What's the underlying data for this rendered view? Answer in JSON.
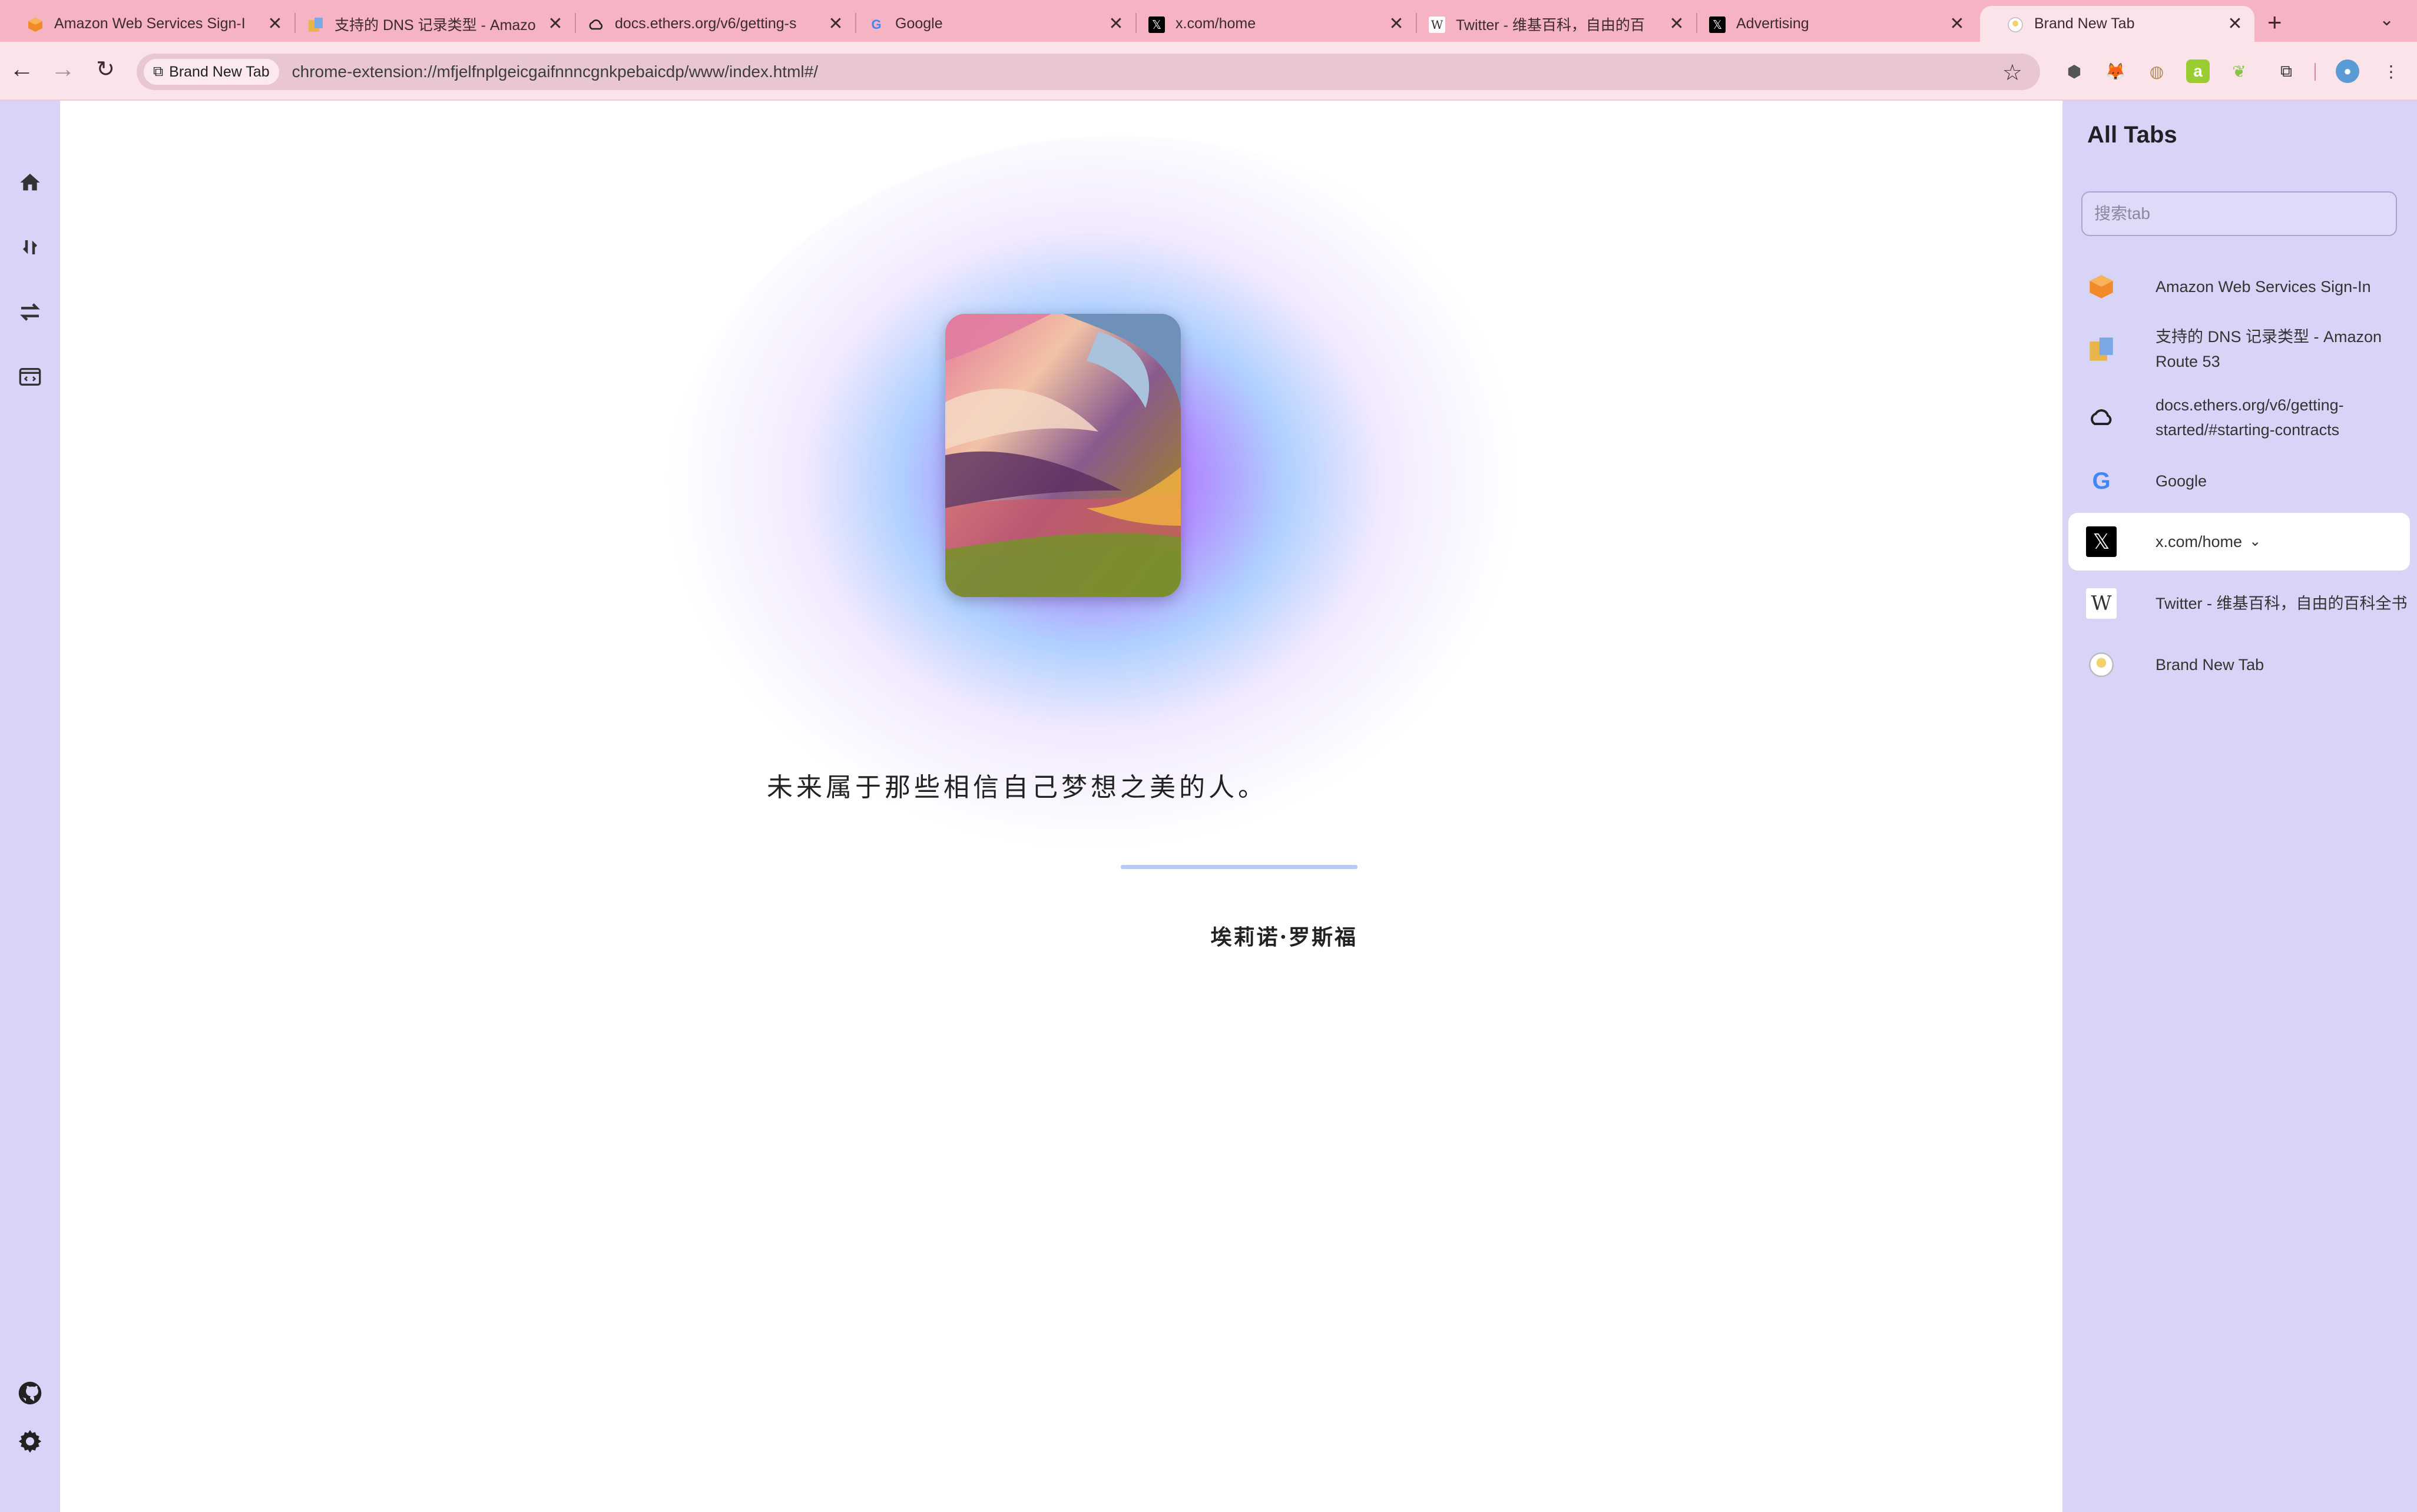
{
  "browser": {
    "tabs": [
      {
        "title": "Amazon Web Services Sign-I",
        "icon": "aws-cube-icon"
      },
      {
        "title": "支持的 DNS 记录类型 - Amazo",
        "icon": "route53-icon"
      },
      {
        "title": "docs.ethers.org/v6/getting-s",
        "icon": "cloud-icon"
      },
      {
        "title": "Google",
        "icon": "google-g-icon"
      },
      {
        "title": "x.com/home",
        "icon": "x-logo-icon"
      },
      {
        "title": "Twitter - 维基百科，自由的百",
        "icon": "wikipedia-w-icon"
      },
      {
        "title": "Advertising",
        "icon": "x-logo-icon"
      },
      {
        "title": "Brand New Tab",
        "icon": "bulb-icon"
      }
    ],
    "site_chip": "Brand New Tab",
    "url": "chrome-extension://mfjelfnplgeicgaifnnncgnkpebaicdp/www/index.html#/"
  },
  "sidebar_left": {
    "items": [
      "home-icon",
      "swap-vertical-icon",
      "swap-arrows-icon",
      "code-window-icon",
      "github-icon",
      "settings-icon"
    ]
  },
  "main": {
    "quote": "未来属于那些相信自己梦想之美的人。",
    "author": "埃莉诺·罗斯福"
  },
  "panel": {
    "title": "All Tabs",
    "search_placeholder": "搜索tab",
    "items": [
      {
        "title": "Amazon Web Services Sign-In",
        "icon": "aws-cube-icon"
      },
      {
        "title": "支持的 DNS 记录类型 - Amazon Route 53",
        "icon": "route53-icon"
      },
      {
        "title": "docs.ethers.org/v6/getting-started/#starting-contracts",
        "icon": "cloud-icon"
      },
      {
        "title": "Google",
        "icon": "google-g-icon"
      },
      {
        "title": "x.com/home",
        "icon": "x-logo-icon"
      },
      {
        "title": "Twitter - 维基百科，自由的百科全书",
        "icon": "wikipedia-w-icon"
      },
      {
        "title": "Brand New Tab",
        "icon": "bulb-icon"
      }
    ]
  },
  "colors": {
    "tab_strip": "#f5b3c3",
    "toolbar": "#fbe3ea",
    "sidebar": "#d7d4f7",
    "quote_line": "#b6cbf2"
  }
}
